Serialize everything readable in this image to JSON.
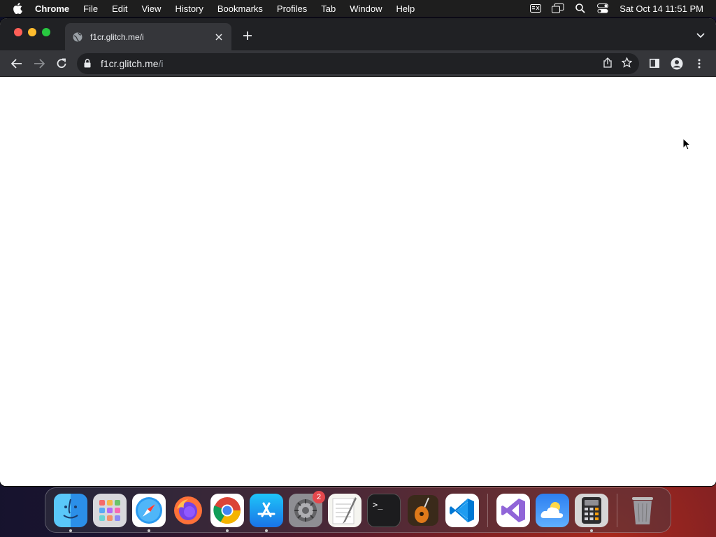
{
  "menubar": {
    "app_name": "Chrome",
    "items": [
      "File",
      "Edit",
      "View",
      "History",
      "Bookmarks",
      "Profiles",
      "Tab",
      "Window",
      "Help"
    ],
    "clock": "Sat Oct 14  11:51 PM"
  },
  "browser": {
    "tab": {
      "title": "f1cr.glitch.me/i"
    },
    "omnibox": {
      "host": "f1cr.glitch.me",
      "path": "/i"
    }
  },
  "dock": {
    "apps": [
      {
        "name": "Finder",
        "running": true
      },
      {
        "name": "Launchpad",
        "running": false
      },
      {
        "name": "Safari",
        "running": true
      },
      {
        "name": "Firefox",
        "running": false
      },
      {
        "name": "Chrome",
        "running": true
      },
      {
        "name": "App Store",
        "running": true
      },
      {
        "name": "System Settings",
        "running": false,
        "badge": "2"
      },
      {
        "name": "TextEdit",
        "running": false
      },
      {
        "name": "Terminal",
        "running": false
      },
      {
        "name": "GarageBand",
        "running": false
      },
      {
        "name": "Visual Studio Code",
        "running": false
      },
      {
        "name": "Visual Studio",
        "running": false
      },
      {
        "name": "Weather",
        "running": false
      },
      {
        "name": "Calculator",
        "running": true
      },
      {
        "name": "Trash",
        "running": false
      }
    ]
  },
  "colors": {
    "menubar_bg": "#1e1e1e",
    "tabstrip_bg": "#202124",
    "toolbar_bg": "#35363a",
    "omnibox_bg": "#202124"
  }
}
